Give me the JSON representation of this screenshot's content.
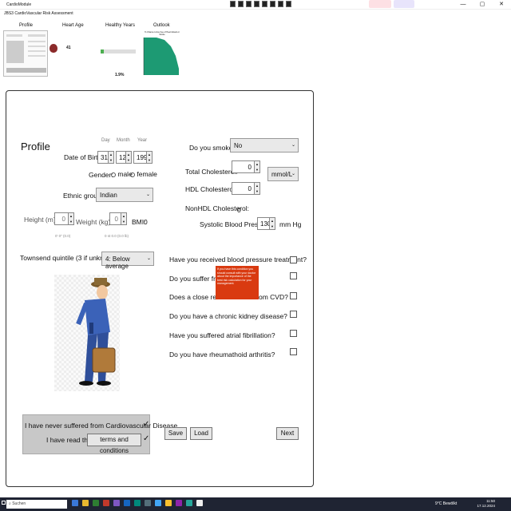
{
  "window": {
    "title": "CardioModule",
    "minimize": "—",
    "maximize": "▢",
    "close": "✕"
  },
  "app": {
    "title": "JBS3 CardioVascular Risk Assessment",
    "tabs": [
      "Profile",
      "Heart Age",
      "Healthy Years",
      "Outlook"
    ]
  },
  "thumbs": {
    "heart_age_value": "41",
    "healthy_years_value": "1.9%",
    "outlook_title": "% Chance to live free of Heart Attack or Stroke"
  },
  "form": {
    "title": "Profile",
    "dob": {
      "label": "Date of Birth",
      "day_label": "Day",
      "month_label": "Month",
      "year_label": "Year",
      "day": "31",
      "month": "12",
      "year": "1990"
    },
    "gender": {
      "label": "Gender:",
      "male": "male",
      "female": "female"
    },
    "ethnic": {
      "label": "Ethnic group",
      "value": "Indian"
    },
    "height": {
      "label": "Height (m):",
      "value": "0",
      "hint": "0' 0\" (0.0)"
    },
    "weight": {
      "label": "Weight (kg):",
      "value": "0",
      "hint": "0 st 0.0 (0.0 lb)"
    },
    "bmi": {
      "label": "BMI:",
      "value": "0"
    },
    "townsend": {
      "label": "Townsend quintile (3 if unknown):",
      "value": "4: Below average"
    },
    "smoke": {
      "label": "Do you smoke?",
      "value": "No"
    },
    "total_chol": {
      "label": "Total Cholesterol:",
      "value": "0"
    },
    "chol_unit": "mmol/L",
    "hdl_chol": {
      "label": "HDL Cholesterol:",
      "value": "0"
    },
    "nonhdl": {
      "label": "NonHDL Cholesterol:",
      "value": "0"
    },
    "systolic": {
      "label": "Systolic Blood Pressure:",
      "value": "130",
      "unit": "mm Hg"
    },
    "questions": [
      "Have you received blood pressure treatment?",
      "Do you suffer from d",
      "Does a close relative",
      "Do you have a chronic kidney disease?",
      "Have you suffered atrial fibrillation?",
      "Do you have rheumathoid arthritis?"
    ],
    "question_tails": [
      "",
      "",
      "om CVD?",
      "",
      "",
      ""
    ],
    "tooltip": "If you have this condition you should consult with your doctor about the importance of the best risk calculation for your management.",
    "never_cvd": "I have never suffered from Cardiovascular Disease",
    "read_terms": "I have read the",
    "terms_button": "terms and conditions",
    "save": "Save",
    "load": "Load",
    "next": "Next"
  },
  "taskbar": {
    "search": "Suchen",
    "tray_label": "9°C Bewölkt",
    "time": "11:50",
    "date": "17.12.2024"
  },
  "colors": {
    "tooltip": "#d93a10",
    "outlook_area": "#1d9a73",
    "taskbar": "#1f2433"
  }
}
